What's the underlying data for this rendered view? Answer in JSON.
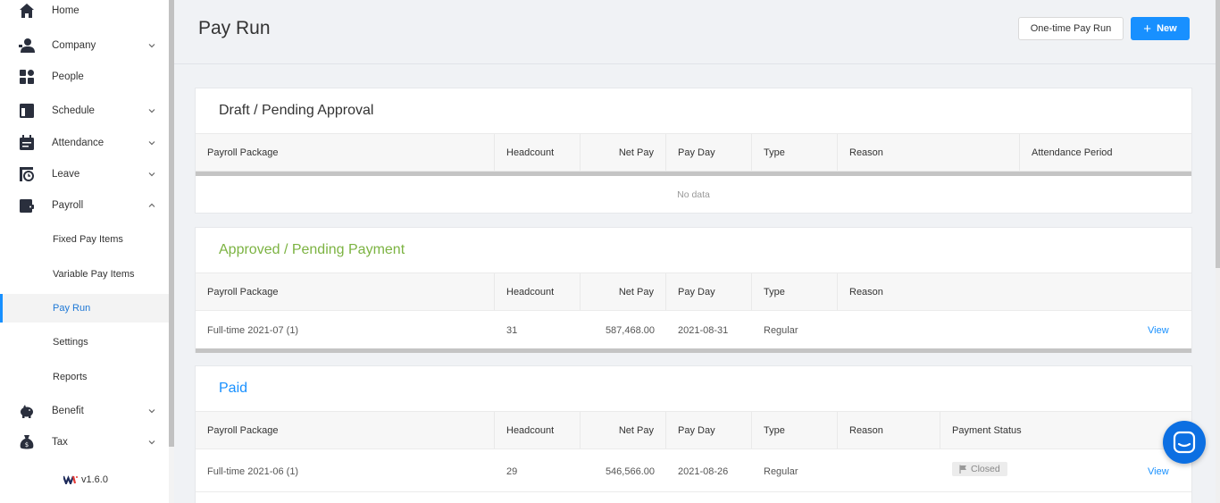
{
  "sidebar": {
    "items": [
      {
        "label": "Home",
        "icon": "home-icon"
      },
      {
        "label": "Company",
        "icon": "company-icon"
      },
      {
        "label": "People",
        "icon": "people-icon"
      },
      {
        "label": "Schedule",
        "icon": "schedule-icon"
      },
      {
        "label": "Attendance",
        "icon": "attendance-icon"
      },
      {
        "label": "Leave",
        "icon": "leave-icon"
      },
      {
        "label": "Payroll",
        "icon": "wallet-icon"
      },
      {
        "label": "Fixed Pay Items"
      },
      {
        "label": "Variable Pay Items"
      },
      {
        "label": "Pay Run"
      },
      {
        "label": "Settings"
      },
      {
        "label": "Reports"
      },
      {
        "label": "Benefit",
        "icon": "piggy-bank-icon"
      },
      {
        "label": "Tax",
        "icon": "money-bag-icon"
      }
    ],
    "active": "Pay Run",
    "version": "v1.6.0"
  },
  "header": {
    "title": "Pay Run",
    "onetime_label": "One-time Pay Run",
    "new_label": "New"
  },
  "colors": {
    "primary": "#1890ff",
    "approved_title": "#7cb342",
    "paid_title": "#1890ff"
  },
  "draft": {
    "title": "Draft / Pending Approval",
    "columns": [
      "Payroll Package",
      "Headcount",
      "Net Pay",
      "Pay Day",
      "Type",
      "Reason",
      "Attendance Period"
    ],
    "empty_text": "No data"
  },
  "approved": {
    "title": "Approved / Pending Payment",
    "columns": [
      "Payroll Package",
      "Headcount",
      "Net Pay",
      "Pay Day",
      "Type",
      "Reason"
    ],
    "rows": [
      {
        "package": "Full-time 2021-07 (1)",
        "headcount": "31",
        "net_pay": "587,468.00",
        "pay_day": "2021-08-31",
        "type": "Regular",
        "reason": "",
        "action": "View"
      }
    ]
  },
  "paid": {
    "title": "Paid",
    "columns": [
      "Payroll Package",
      "Headcount",
      "Net Pay",
      "Pay Day",
      "Type",
      "Reason",
      "Payment Status"
    ],
    "rows": [
      {
        "package": "Full-time 2021-06 (1)",
        "headcount": "29",
        "net_pay": "546,566.00",
        "pay_day": "2021-08-26",
        "type": "Regular",
        "reason": "",
        "status": "Closed",
        "action": "View"
      }
    ]
  }
}
